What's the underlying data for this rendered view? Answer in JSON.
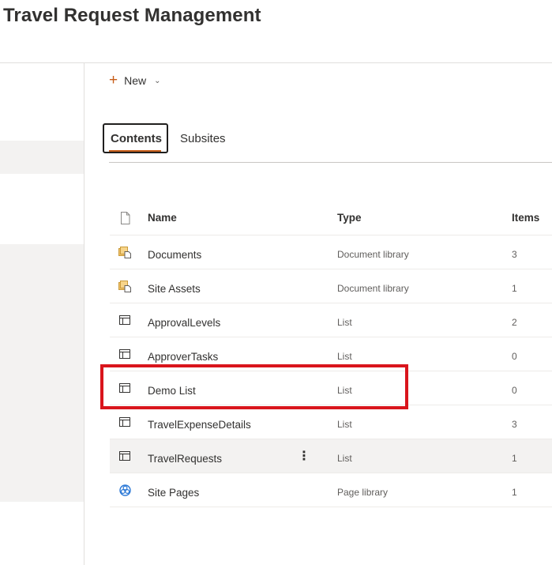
{
  "header": {
    "site_title": "Travel Request Management"
  },
  "command_bar": {
    "new_label": "New"
  },
  "tabs": [
    {
      "label": "Contents",
      "selected": true
    },
    {
      "label": "Subsites",
      "selected": false
    }
  ],
  "list": {
    "columns": {
      "name": "Name",
      "type": "Type",
      "items": "Items"
    },
    "rows": [
      {
        "name": "Documents",
        "type": "Document library",
        "items": "3",
        "icon": "document-library-icon"
      },
      {
        "name": "Site Assets",
        "type": "Document library",
        "items": "1",
        "icon": "document-library-icon"
      },
      {
        "name": "ApprovalLevels",
        "type": "List",
        "items": "2",
        "icon": "list-icon"
      },
      {
        "name": "ApproverTasks",
        "type": "List",
        "items": "0",
        "icon": "list-icon"
      },
      {
        "name": "Demo List",
        "type": "List",
        "items": "0",
        "icon": "list-icon"
      },
      {
        "name": "TravelExpenseDetails",
        "type": "List",
        "items": "3",
        "icon": "list-icon"
      },
      {
        "name": "TravelRequests",
        "type": "List",
        "items": "1",
        "icon": "list-icon",
        "hovered": true
      },
      {
        "name": "Site Pages",
        "type": "Page library",
        "items": "1",
        "icon": "page-library-icon"
      }
    ]
  },
  "colors": {
    "accent": "#c75d18",
    "highlight": "#d9151c",
    "selected_row": "#f3f2f1"
  }
}
